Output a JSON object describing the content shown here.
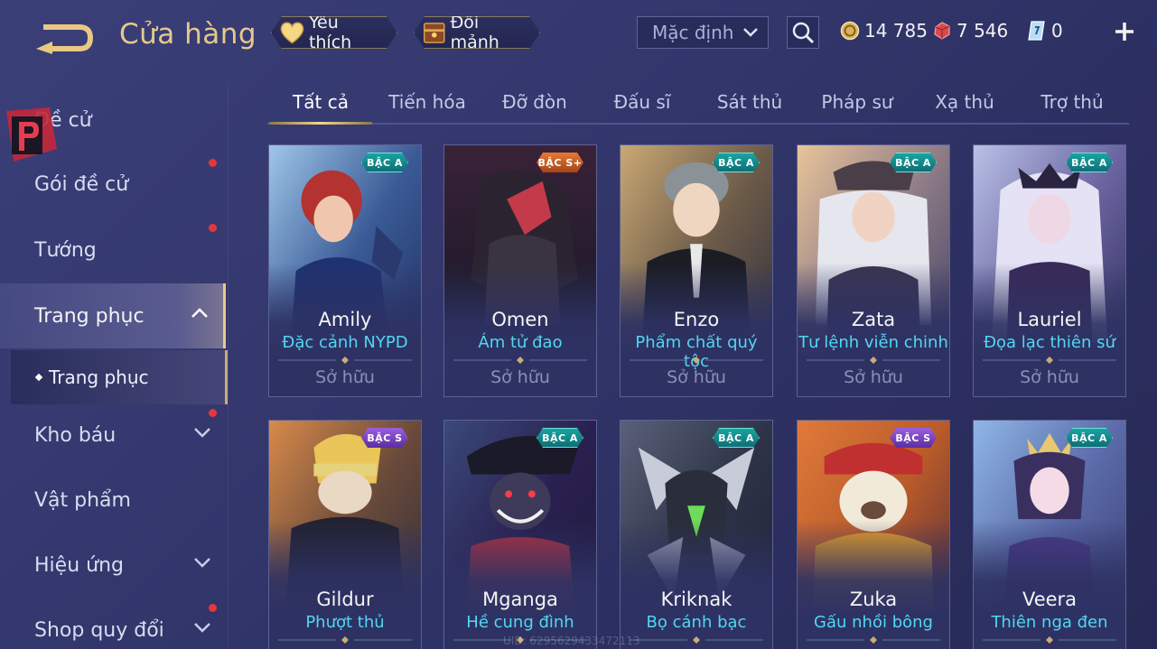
{
  "header": {
    "title": "Cửa hàng",
    "favorite_label": "Yêu thích",
    "trade_label": "Đổi mảnh",
    "sort_selected": "Mặc định"
  },
  "currency": {
    "gold": "14 785",
    "ruby": "7 546",
    "voucher": "0"
  },
  "sidebar": {
    "items": [
      {
        "label": "Đề cử",
        "dot": false
      },
      {
        "label": "Gói đề cử",
        "dot": true
      },
      {
        "label": "Tướng",
        "dot": true
      },
      {
        "label": "Trang phục",
        "dot": false,
        "expanded": true
      },
      {
        "label": "Kho báu",
        "dot": true
      },
      {
        "label": "Vật phẩm",
        "dot": false
      },
      {
        "label": "Hiệu ứng",
        "dot": false
      },
      {
        "label": "Shop quy đổi",
        "dot": true
      }
    ],
    "sub_item": "Trang phục"
  },
  "tabs": [
    "Tất cả",
    "Tiến hóa",
    "Đỡ đòn",
    "Đấu sĩ",
    "Sát thủ",
    "Pháp sư",
    "Xạ thủ",
    "Trợ thủ"
  ],
  "active_tab": "Tất cả",
  "cards": [
    {
      "hero": "Amily",
      "skin": "Đặc cảnh NYPD",
      "tier": "BẬC A",
      "status": "Sở hữu"
    },
    {
      "hero": "Omen",
      "skin": "Ám tử đao",
      "tier": "BẬC S+",
      "status": "Sở hữu"
    },
    {
      "hero": "Enzo",
      "skin": "Phẩm chất quý tộc",
      "tier": "BẬC A",
      "status": "Sở hữu"
    },
    {
      "hero": "Zata",
      "skin": "Tư lệnh viễn chinh",
      "tier": "BẬC A",
      "status": "Sở hữu"
    },
    {
      "hero": "Lauriel",
      "skin": "Đọa lạc thiên sứ",
      "tier": "BẬC A",
      "status": "Sở hữu"
    },
    {
      "hero": "Gildur",
      "skin": "Phượt thủ",
      "tier": "BẬC S"
    },
    {
      "hero": "Mganga",
      "skin": "Hề cung đình",
      "tier": "BẬC A"
    },
    {
      "hero": "Kriknak",
      "skin": "Bọ cánh bạc",
      "tier": "BẬC A"
    },
    {
      "hero": "Zuka",
      "skin": "Gấu nhồi bông",
      "tier": "BẬC S"
    },
    {
      "hero": "Veera",
      "skin": "Thiên nga đen",
      "tier": "BẬC A"
    }
  ],
  "uid_text": "UID: 6295629433472113",
  "colors": {
    "title_gold": "#e6c98a",
    "skin_cyan": "#52d6f2",
    "notify_red": "#e6373b",
    "tier_a": "#1aa7a3",
    "tier_s_plus": "#e57a34",
    "tier_s": "#9b5fe0"
  }
}
